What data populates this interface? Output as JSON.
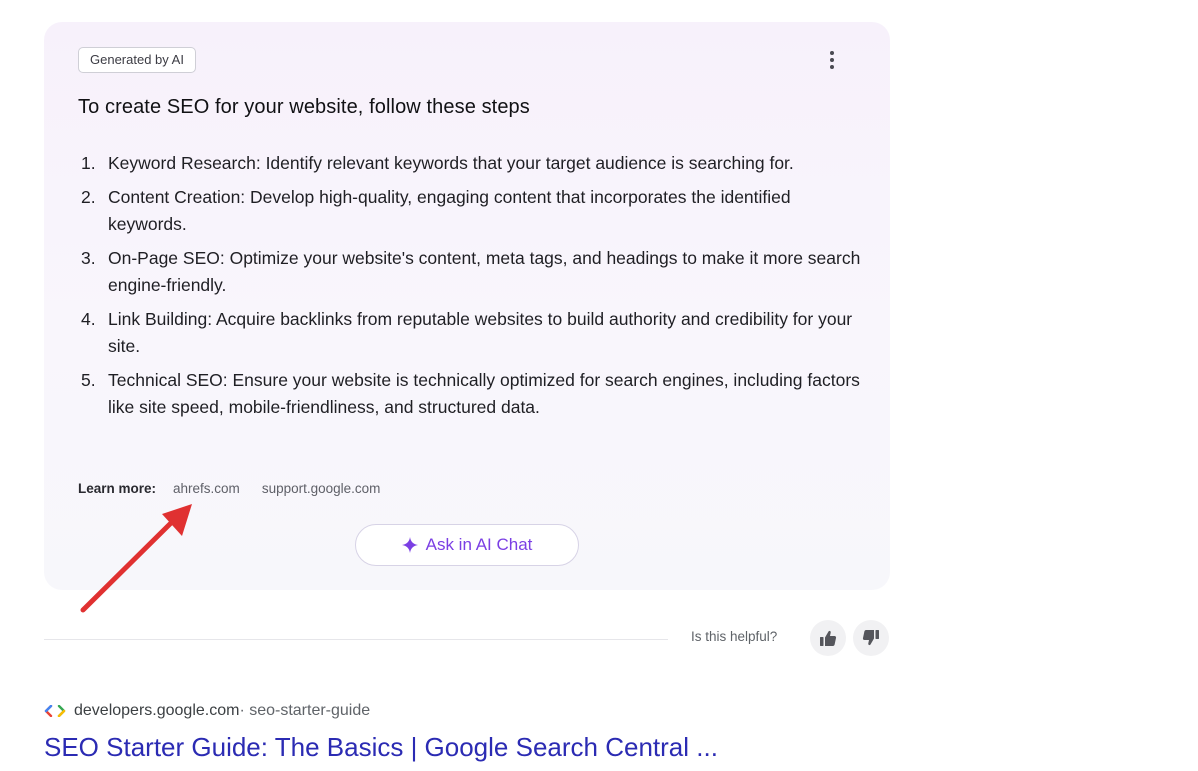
{
  "ai_answer": {
    "badge": "Generated by AI",
    "heading": "To create SEO for your website, follow these steps",
    "steps": [
      {
        "num": "1.",
        "text": "Keyword Research: Identify relevant keywords that your target audience is searching for."
      },
      {
        "num": "2.",
        "text": "Content Creation: Develop high-quality, engaging content that incorporates the identified keywords."
      },
      {
        "num": "3.",
        "text": "On-Page SEO: Optimize your website's content, meta tags, and headings to make it more search engine-friendly."
      },
      {
        "num": "4.",
        "text": "Link Building: Acquire backlinks from reputable websites to build authority and credibility for your site."
      },
      {
        "num": "5.",
        "text": "Technical SEO: Ensure your website is technically optimized for search engines, including factors like site speed, mobile-friendliness, and structured data."
      }
    ],
    "learn_more_label": "Learn more:",
    "sources": [
      "ahrefs.com",
      "support.google.com"
    ],
    "ask_button_label": "Ask in AI Chat",
    "menu_icon": "more-vertical-icon",
    "accent_color": "#7b3fe4"
  },
  "feedback": {
    "question": "Is this helpful?",
    "up_icon": "thumbs-up-icon",
    "down_icon": "thumbs-down-icon"
  },
  "annotation": {
    "arrow_color": "#e03131",
    "arrow_icon": "red-arrow-annotation"
  },
  "result": {
    "domain": "developers.google.com",
    "path": " · seo-starter-guide",
    "title": "SEO Starter Guide: The Basics | Google Search Central ...",
    "title_color": "#2b2bb3"
  }
}
